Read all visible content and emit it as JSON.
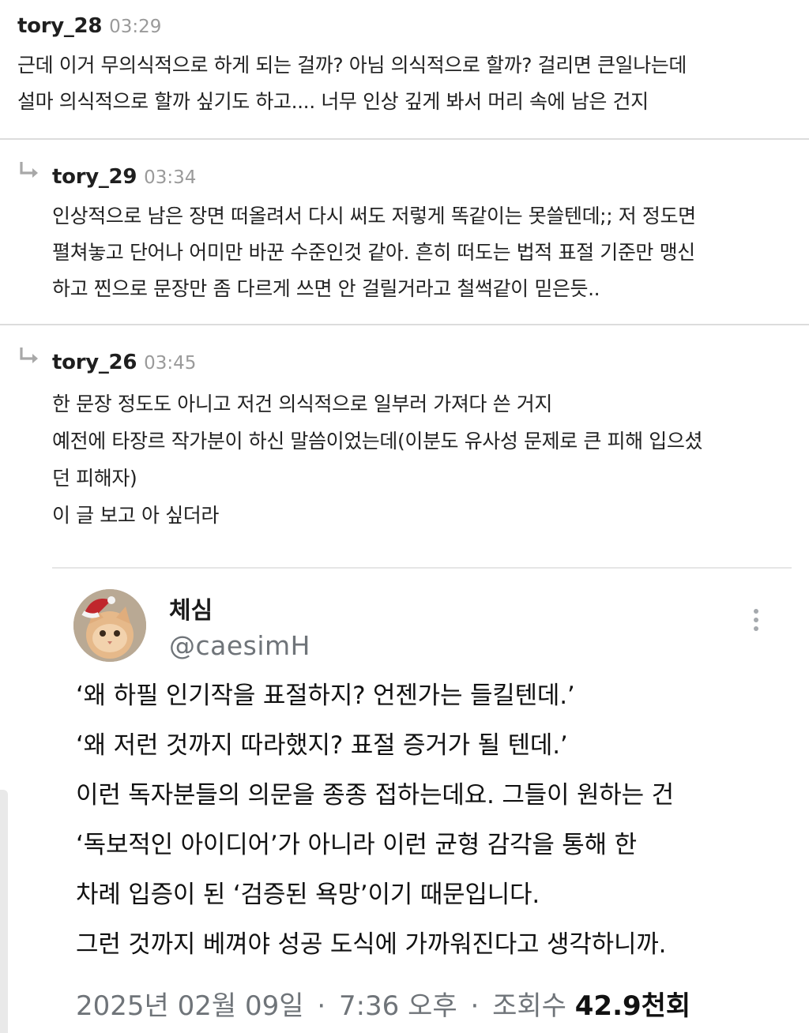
{
  "comments": [
    {
      "author": "tory_28",
      "time": "03:29",
      "lines": [
        "근데 이거 무의식적으로 하게 되는 걸까? 아님 의식적으로 할까? 걸리면 큰일나는데",
        "설마 의식적으로 할까 싶기도 하고.... 너무 인상 깊게 봐서 머리 속에 남은 건지"
      ]
    },
    {
      "author": "tory_29",
      "time": "03:34",
      "lines": [
        "인상적으로 남은 장면 떠올려서 다시 써도 저렇게 똑같이는 못쓸텐데;; 저 정도면",
        "펼쳐놓고 단어나 어미만 바꾼 수준인것 같아. 흔히 떠도는 법적 표절 기준만 맹신",
        "하고 찐으로 문장만 좀 다르게 쓰면 안 걸릴거라고 철썩같이 믿은듯.."
      ]
    },
    {
      "author": "tory_26",
      "time": "03:45",
      "lines": [
        "한 문장 정도도 아니고 저건 의식적으로 일부러 가져다 쓴 거지",
        "예전에 타장르 작가분이 하신 말씀이었는데(이분도 유사성 문제로 큰 피해 입으셨",
        "던 피해자)",
        "이 글 보고 아 싶더라"
      ]
    }
  ],
  "tweet": {
    "name": "체심",
    "handle": "@caesimH",
    "avatar_icon": "cat-with-santa-hat-avatar",
    "more_icon": "more-vertical-icon",
    "lines": [
      "‘왜 하필 인기작을 표절하지? 언젠가는 들킬텐데.’",
      "‘왜 저런 것까지 따라했지? 표절 증거가 될 텐데.’",
      "이런 독자분들의 의문을 종종 접하는데요. 그들이 원하는 건",
      "‘독보적인 아이디어’가 아니라 이런 균형 감각을 통해 한",
      "차례 입증이 된 ‘검증된 욕망’이기 때문입니다.",
      "그런 것까지 베껴야 성공 도식에 가까워진다고 생각하니까."
    ],
    "date": "2025년 02월 09일",
    "time": "7:36 오후",
    "views_label": "조회수",
    "views": "42.9천회",
    "separator": "·"
  },
  "icons": {
    "reply": "reply-arrow-icon"
  },
  "colors": {
    "author": "#1f1f1f",
    "timestamp": "#9a9a9a",
    "divider": "#dcdcdc",
    "tweet_meta": "#6f7479"
  }
}
